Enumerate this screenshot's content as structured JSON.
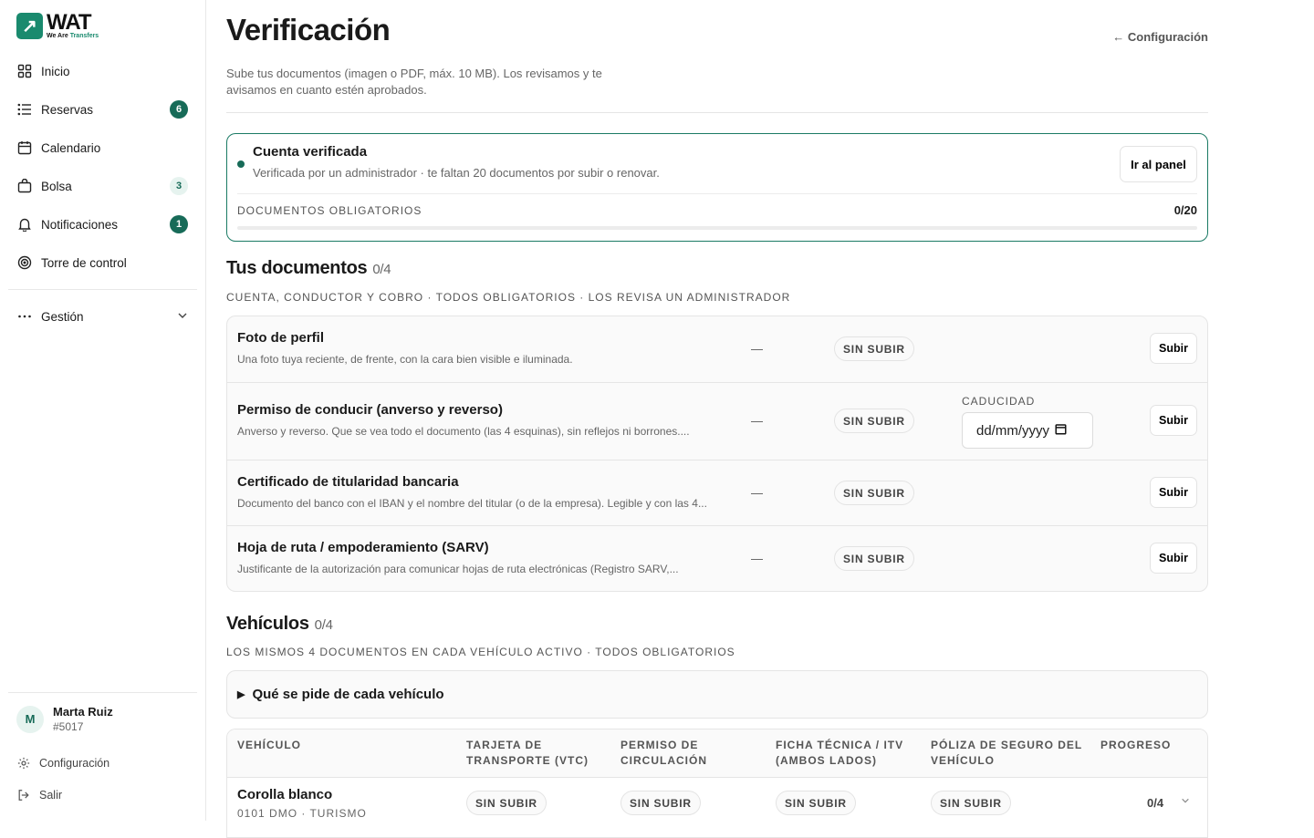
{
  "brand": {
    "word": "WAT",
    "sub_prefix": "We Are ",
    "sub_accent": "Transfers",
    "mark": "↗"
  },
  "sidebar": {
    "items": [
      {
        "label": "Inicio",
        "icon": "grid-icon"
      },
      {
        "label": "Reservas",
        "icon": "list-icon",
        "badge": "6"
      },
      {
        "label": "Calendario",
        "icon": "calendar-icon"
      },
      {
        "label": "Bolsa",
        "icon": "bag-icon",
        "badge": "3"
      },
      {
        "label": "Notificaciones",
        "icon": "bell-icon",
        "badge": "1"
      },
      {
        "label": "Torre de control",
        "icon": "target-icon"
      }
    ],
    "group": {
      "label": "Gestión",
      "icon": "more-dots-icon"
    }
  },
  "user": {
    "initial": "M",
    "name": "Marta Ruiz",
    "id": "#5017"
  },
  "footer": {
    "settings": "Configuración",
    "logout": "Salir"
  },
  "page": {
    "title": "Verificación",
    "back": "← Configuración",
    "subtitle": "Sube tus documentos (imagen o PDF, máx. 10 MB). Los revisamos y te avisamos en cuanto estén aprobados."
  },
  "status": {
    "title": "Cuenta verificada",
    "desc": "Verificada por un administrador · te faltan 20 documentos por subir o renovar.",
    "button": "Ir al panel",
    "required_label": "DOCUMENTOS OBLIGATORIOS",
    "count": "0/20",
    "progress": 0
  },
  "documents": {
    "title": "Tus documentos",
    "count": "0/4",
    "caption": "CUENTA, CONDUCTOR Y COBRO · TODOS OBLIGATORIOS · LOS REVISA UN ADMINISTRADOR",
    "expiry_label": "CADUCIDAD",
    "expiry_placeholder": "dd/mm/yyyy",
    "rows": [
      {
        "title": "Foto de perfil",
        "desc": "Una foto tuya reciente, de frente, con la cara bien visible e iluminada.",
        "dash": "—",
        "status": "SIN SUBIR",
        "action": "Subir"
      },
      {
        "title": "Permiso de conducir (anverso y reverso)",
        "desc": "Anverso y reverso. Que se vea todo el documento (las 4 esquinas), sin reflejos ni borrones....",
        "dash": "—",
        "status": "SIN SUBIR",
        "action": "Subir"
      },
      {
        "title": "Certificado de titularidad bancaria",
        "desc": "Documento del banco con el IBAN y el nombre del titular (o de la empresa). Legible y con las 4...",
        "dash": "—",
        "status": "SIN SUBIR",
        "action": "Subir"
      },
      {
        "title": "Hoja de ruta / empoderamiento (SARV)",
        "desc": "Justificante de la autorización para comunicar hojas de ruta electrónicas (Registro SARV,...",
        "dash": "—",
        "status": "SIN SUBIR",
        "action": "Subir"
      }
    ]
  },
  "vehicles": {
    "title": "Vehículos",
    "count": "0/4",
    "caption": "LOS MISMOS 4 DOCUMENTOS EN CADA VEHÍCULO ACTIVO · TODOS OBLIGATORIOS",
    "details": "Qué se pide de cada vehículo",
    "headers": [
      "VEHÍCULO",
      "TARJETA DE TRANSPORTE (VTC)",
      "PERMISO DE CIRCULACIÓN",
      "FICHA TÉCNICA / ITV (AMBOS LADOS)",
      "PÓLIZA DE SEGURO DEL VEHÍCULO",
      "PROGRESO"
    ],
    "rows": [
      {
        "name": "Corolla blanco",
        "plate": "0101 DMO · TURISMO",
        "statuses": [
          "SIN SUBIR",
          "SIN SUBIR",
          "SIN SUBIR",
          "SIN SUBIR"
        ],
        "progress": "0/4"
      }
    ]
  },
  "colors": {
    "accent": "#176b58",
    "border_accent": "#1a7a64"
  }
}
